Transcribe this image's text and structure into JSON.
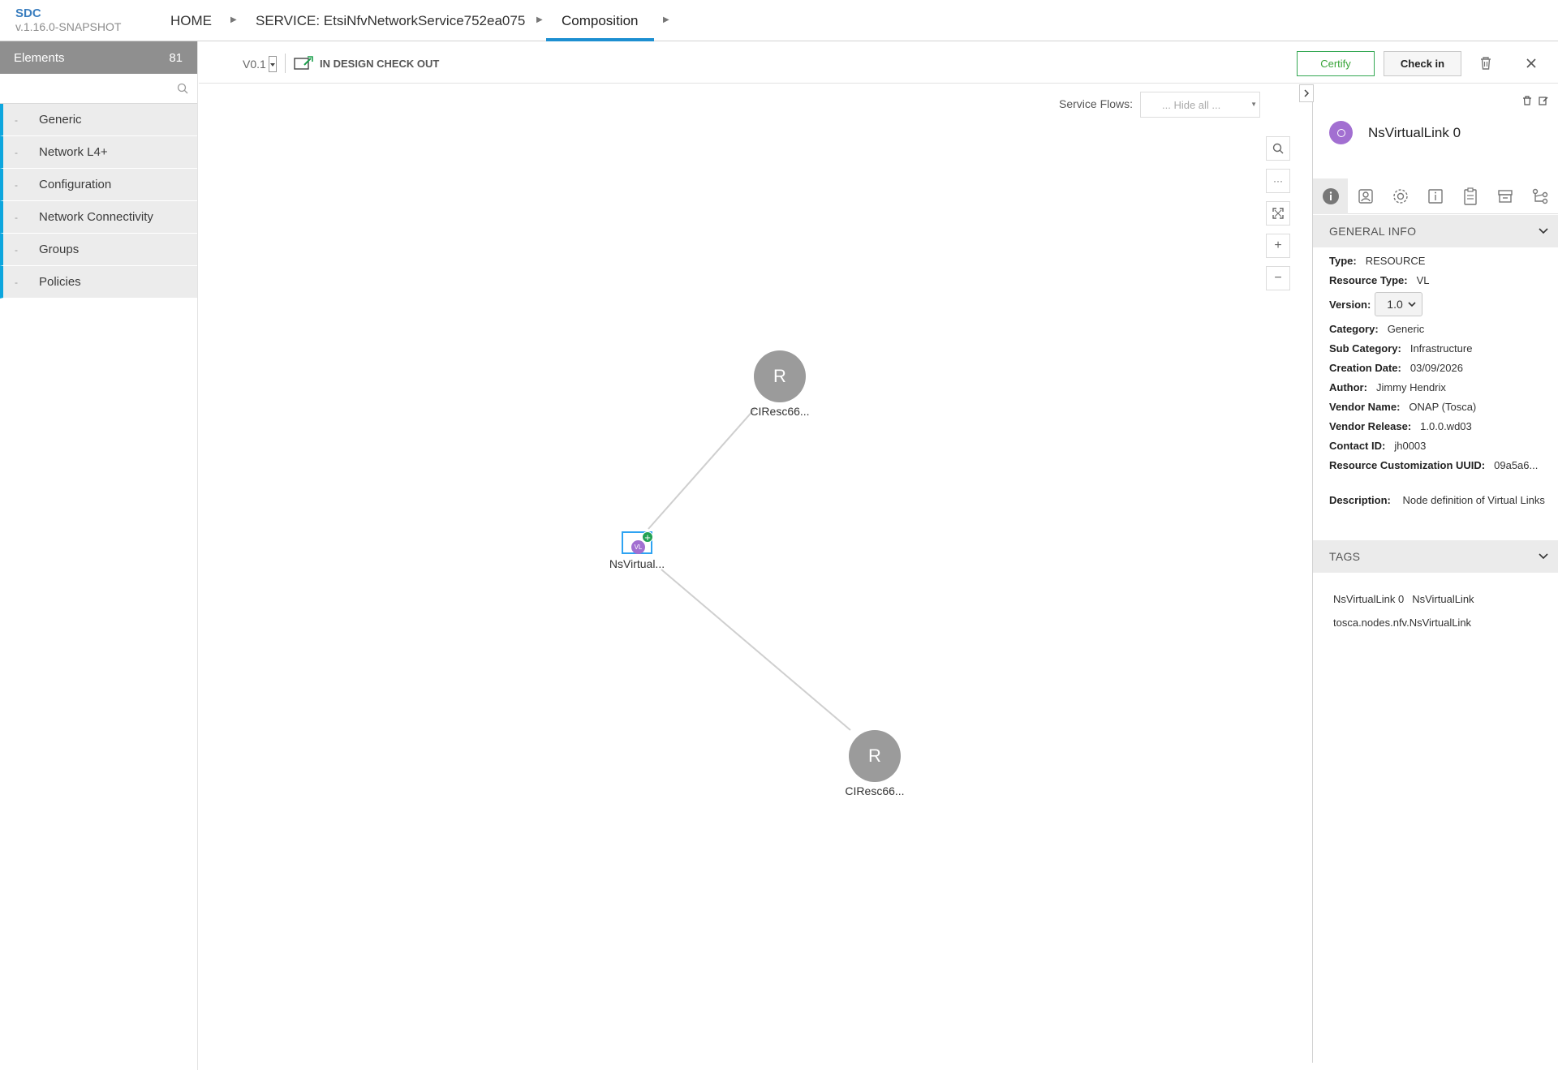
{
  "app": {
    "name": "SDC",
    "version": "v.1.16.0-SNAPSHOT"
  },
  "breadcrumb": {
    "home": "HOME",
    "service": "SERVICE: EtsiNfvNetworkService752ea075",
    "current": "Composition"
  },
  "palette": {
    "title": "Elements",
    "count": "81",
    "search_placeholder": "",
    "items": [
      {
        "dash": "-",
        "label": "Generic"
      },
      {
        "dash": "-",
        "label": "Network L4+"
      },
      {
        "dash": "-",
        "label": "Configuration"
      },
      {
        "dash": "-",
        "label": "Network Connectivity"
      },
      {
        "dash": "-",
        "label": "Groups"
      },
      {
        "dash": "-",
        "label": "Policies"
      }
    ]
  },
  "toolbar": {
    "version": "V0.1",
    "status": "IN DESIGN CHECK OUT",
    "certify_label": "Certify",
    "checkin_label": "Check in"
  },
  "canvas": {
    "service_flows_label": "Service Flows:",
    "service_flows_value": "... Hide all ...",
    "zoom_more": "···",
    "zoom_in": "+",
    "zoom_out": "−",
    "nodes": [
      {
        "letter": "R",
        "label": "CIResc66..."
      },
      {
        "label": "NsVirtual...",
        "badge": "VL",
        "plus": "+"
      },
      {
        "letter": "R",
        "label": "CIResc66..."
      }
    ]
  },
  "panel": {
    "title": "NsVirtualLink 0",
    "general_info_title": "GENERAL INFO",
    "fields": {
      "type_label": "Type:",
      "type_value": "RESOURCE",
      "rtype_label": "Resource Type:",
      "rtype_value": "VL",
      "version_label": "Version:",
      "version_value": "1.0",
      "category_label": "Category:",
      "category_value": "Generic",
      "subcat_label": "Sub Category:",
      "subcat_value": "Infrastructure",
      "created_label": "Creation Date:",
      "created_value": "03/09/2026",
      "author_label": "Author:",
      "author_value": "Jimmy Hendrix",
      "vendor_label": "Vendor Name:",
      "vendor_value": "ONAP (Tosca)",
      "vrelease_label": "Vendor Release:",
      "vrelease_value": "1.0.0.wd03",
      "contact_label": "Contact ID:",
      "contact_value": "jh0003",
      "uuid_label": "Resource Customization UUID:",
      "uuid_value": "09a5a6...",
      "desc_label": "Description:",
      "desc_value": "Node definition of Virtual Links"
    },
    "tags_title": "TAGS",
    "tags": [
      "NsVirtualLink 0",
      "NsVirtualLink",
      "tosca.nodes.nfv.NsVirtualLink"
    ]
  },
  "colors": {
    "accent": "#1d8fd1",
    "palette_bar": "#0da6de",
    "certify": "#34a853",
    "vl_node": "#a26fd1",
    "resource_node": "#9b9b9b"
  }
}
